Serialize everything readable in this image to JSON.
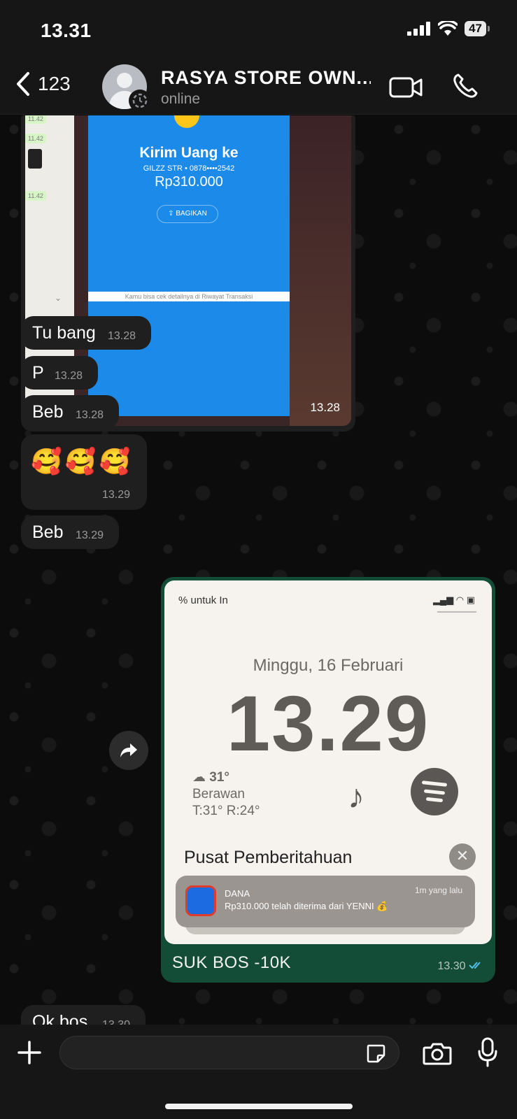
{
  "status_bar": {
    "time": "13.31",
    "battery": "47"
  },
  "header": {
    "back_count": "123",
    "contact_name": "RASYA STORE OWN...",
    "contact_status": "online"
  },
  "messages": {
    "img1": {
      "kirim_title": "Kirim Uang ke",
      "recipient": "GILZZ STR • 0878••••2542",
      "amount": "Rp310.000",
      "share_label": "BAGIKAN",
      "footer": "Kamu bisa cek detailnya di Riwayat Transaksi",
      "side_times": [
        "11.42",
        "11.42",
        "11.42"
      ],
      "time": "13.28"
    },
    "m1": {
      "text": "Tu bang",
      "time": "13.28"
    },
    "m2": {
      "text": "P",
      "time": "13.28"
    },
    "m3": {
      "text": "Beb",
      "time": "13.28"
    },
    "m4": {
      "text": "🥰🥰🥰",
      "time": "13.29"
    },
    "m5": {
      "text": "Beb",
      "time": "13.29"
    },
    "img2": {
      "top_text": "% untuk In",
      "date": "Minggu, 16 Februari",
      "clock": "13.29",
      "temp": "31°",
      "condition": "Berawan",
      "range": "T:31° R:24°",
      "notif_center": "Pusat Pemberitahuan",
      "notif_app": "DANA",
      "notif_time": "1m yang lalu",
      "notif_body": "Rp310.000 telah diterima dari YENNI 💰"
    },
    "out": {
      "text": "SUK BOS -10K",
      "time": "13.30"
    },
    "m6": {
      "text": "Ok bos",
      "time": "13.30"
    }
  },
  "composer": {
    "placeholder": ""
  },
  "colors": {
    "header_bg": "#161616",
    "bubble_in": "#1f1f1f",
    "bubble_out": "#134d37",
    "tick": "#53bdeb"
  }
}
